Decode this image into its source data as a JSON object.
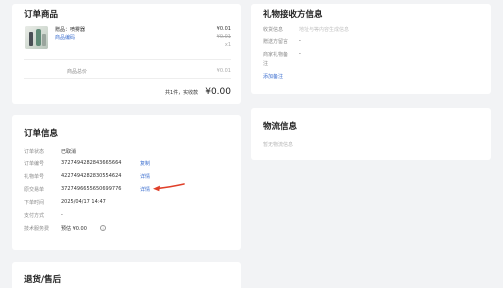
{
  "products_card": {
    "title": "订单商品",
    "item": {
      "name": "赠品：喷雾器",
      "code_link": "商品编码",
      "price": "¥0.01",
      "price_original": "¥0.01",
      "qty": "x1"
    },
    "total_label": "商品总价",
    "total_value": "¥0.01",
    "summary_prefix": "共1件，实收款",
    "summary_amount": "¥0.00"
  },
  "gift_card": {
    "title": "礼物接收方信息",
    "rows": [
      {
        "label": "收货信息",
        "value": "地址与等内容生成信息"
      },
      {
        "label": "赠送方留言",
        "value": "-"
      },
      {
        "label": "商家礼物备注",
        "value": "-"
      }
    ],
    "add_note_link": "添加备注"
  },
  "order_card": {
    "title": "订单信息",
    "rows": [
      {
        "label": "订单状态",
        "value": "已取消",
        "action": ""
      },
      {
        "label": "订单编号",
        "value": "3727494282843665664",
        "action": "复制"
      },
      {
        "label": "礼物单号",
        "value": "4227494282830554624",
        "action": "详情"
      },
      {
        "label": "原交易单",
        "value": "3727496655650699776",
        "action": "详情"
      },
      {
        "label": "下单时间",
        "value": "2025/04/17 14:47",
        "action": ""
      },
      {
        "label": "支付方式",
        "value": "-",
        "action": ""
      },
      {
        "label": "技术服务费",
        "value": "预估 ¥0.00",
        "action": ""
      }
    ],
    "info_icon": "info-circle-icon",
    "annotation": "red-arrow-pointing-left"
  },
  "logistics_card": {
    "title": "物流信息",
    "empty_text": "暂无物流信息"
  },
  "after_sales_card": {
    "title": "退货/售后"
  },
  "colors": {
    "background": "#f2f3f5",
    "card": "#ffffff",
    "link": "#3b6ecf",
    "arrow": "#e0402a"
  }
}
